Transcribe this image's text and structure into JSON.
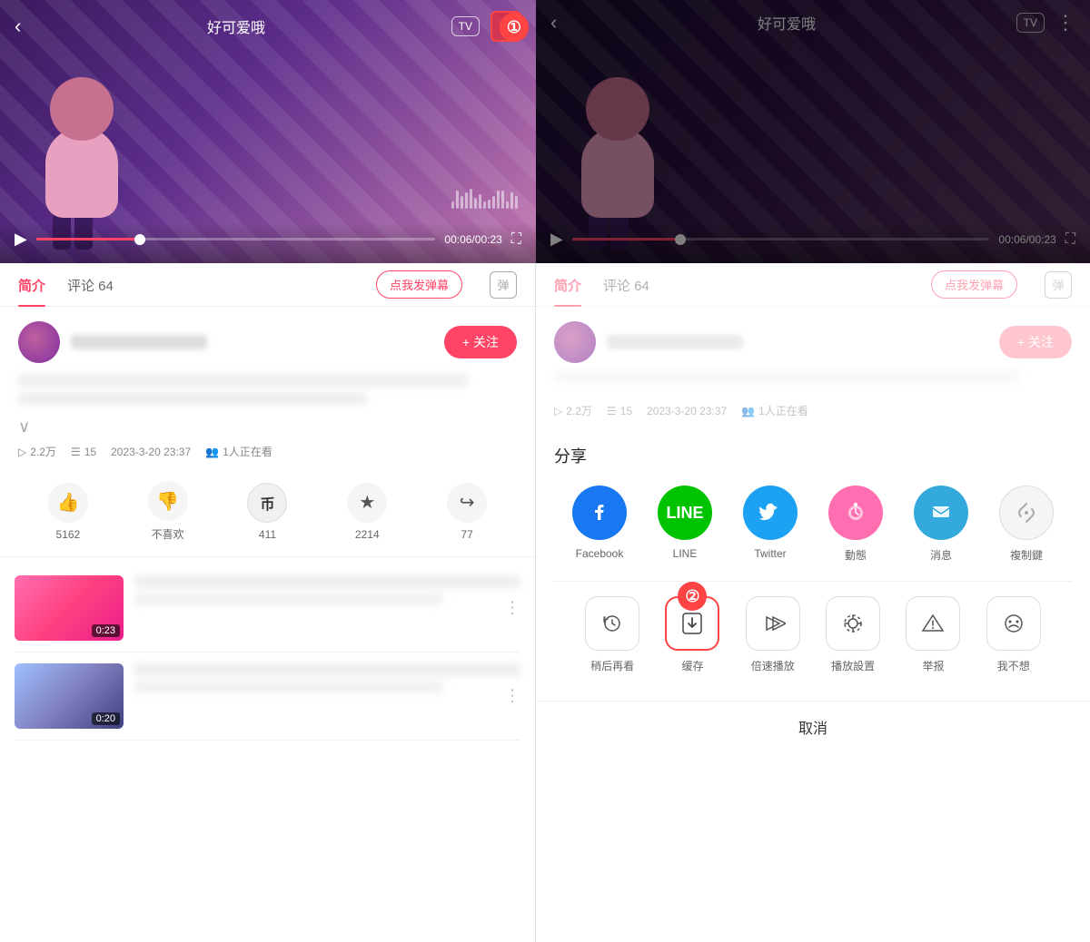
{
  "left": {
    "video": {
      "title": "好可爱哦",
      "back_label": "‹",
      "tv_label": "TV",
      "more_label": "⋮",
      "badge1": "①",
      "time_current": "00:06",
      "time_total": "00:23",
      "progress_percent": 26
    },
    "tabs": [
      {
        "label": "简介",
        "active": true
      },
      {
        "label": "评论 64",
        "active": false
      }
    ],
    "danmu_btn": "点我发弹幕",
    "danmu_icon": "弹",
    "user": {
      "name": "NsuvlFentinade",
      "follow_btn": "+ 关注"
    },
    "stats": {
      "views": "2.2万",
      "comments": "15",
      "date": "2023-3-20 23:37",
      "watching": "1人正在看"
    },
    "actions": [
      {
        "icon": "👍",
        "label": "5162"
      },
      {
        "icon": "👎",
        "label": "不喜欢"
      },
      {
        "icon": "币",
        "label": "411"
      },
      {
        "icon": "★",
        "label": "2214"
      },
      {
        "icon": "↪",
        "label": "77"
      }
    ],
    "related_videos": [
      {
        "duration": "0:23",
        "bg": "pink"
      },
      {
        "duration": "0:20",
        "bg": "dark"
      }
    ]
  },
  "right": {
    "video": {
      "title": "好可爱哦",
      "tv_label": "TV",
      "more_label": "⋮",
      "time_current": "00:06",
      "time_total": "00:23"
    },
    "tabs": [
      {
        "label": "简介",
        "active": true
      },
      {
        "label": "评论 64",
        "active": false
      }
    ],
    "danmu_btn": "点我发弹幕",
    "danmu_icon": "弹",
    "user": {
      "name": "NsuvlFentinade",
      "follow_btn": "+ 关注"
    },
    "stats": {
      "views": "2.2万",
      "comments": "15",
      "date": "2023-3-20 23:37",
      "watching": "1人正在看"
    },
    "share": {
      "title": "分享",
      "badge2": "②",
      "icons": [
        {
          "label": "Facebook",
          "type": "facebook"
        },
        {
          "label": "LINE",
          "type": "line"
        },
        {
          "label": "Twitter",
          "type": "twitter"
        },
        {
          "label": "動態",
          "type": "dongtai"
        },
        {
          "label": "消息",
          "type": "message"
        },
        {
          "label": "複制鍵",
          "type": "copy"
        }
      ],
      "action_icons": [
        {
          "label": "稍后再看",
          "type": "watch-later"
        },
        {
          "label": "缓存",
          "type": "cache",
          "highlighted": true
        },
        {
          "label": "倍速播放",
          "type": "speed"
        },
        {
          "label": "播放設置",
          "type": "settings"
        },
        {
          "label": "举报",
          "type": "report"
        },
        {
          "label": "我不想",
          "type": "dislike"
        }
      ],
      "cancel_label": "取消"
    }
  }
}
